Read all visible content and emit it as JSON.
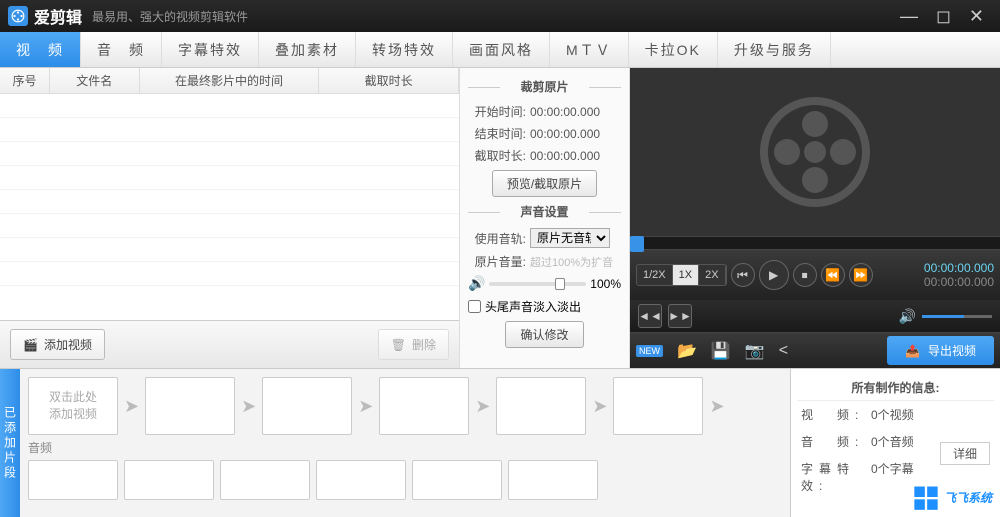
{
  "app": {
    "title": "爱剪辑",
    "subtitle": "最易用、强大的视频剪辑软件"
  },
  "tabs": [
    "视　频",
    "音　频",
    "字幕特效",
    "叠加素材",
    "转场特效",
    "画面风格",
    "MＴＶ",
    "卡拉OK",
    "升级与服务"
  ],
  "grid": {
    "cols": [
      "序号",
      "文件名",
      "在最终影片中的时间",
      "截取时长"
    ]
  },
  "tools": {
    "add": "添加视频",
    "del": "删除"
  },
  "trim": {
    "title": "裁剪原片",
    "start_lbl": "开始时间:",
    "start": "00:00:00.000",
    "end_lbl": "结束时间:",
    "end": "00:00:00.000",
    "dur_lbl": "截取时长:",
    "dur": "00:00:00.000",
    "preview_btn": "预览/截取原片"
  },
  "sound": {
    "title": "声音设置",
    "track_lbl": "使用音轨:",
    "track_sel": "原片无音轨",
    "vol_lbl": "原片音量:",
    "vol_hint": "超过100%为扩音",
    "vol_val": "100%",
    "fade": "头尾声音淡入淡出",
    "confirm": "确认修改"
  },
  "player": {
    "speeds": [
      "1/2X",
      "1X",
      "2X"
    ],
    "time1": "00:00:00.000",
    "time2": "00:00:00.000"
  },
  "export": "导出视频",
  "timeline": {
    "sidebar": "已添加片段",
    "hint": "双击此处\n添加视频",
    "audio_lbl": "音频"
  },
  "info": {
    "title": "所有制作的信息:",
    "rows": [
      {
        "k": "视　频:",
        "v": "0个视频"
      },
      {
        "k": "音　频:",
        "v": "0个音频"
      },
      {
        "k": "字幕特效:",
        "v": "0个字幕"
      }
    ],
    "detail": "详细"
  },
  "watermark": "飞飞系统"
}
